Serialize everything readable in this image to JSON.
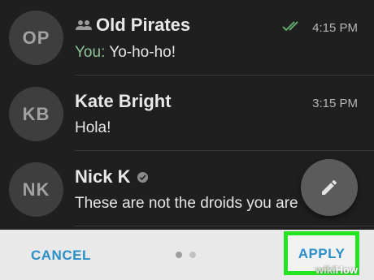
{
  "chats": [
    {
      "initials": "OP",
      "name": "Old Pirates",
      "group": true,
      "verified": false,
      "sender": "You:",
      "preview": "Yo-ho-ho!",
      "time": "4:15 PM",
      "read": true
    },
    {
      "initials": "KB",
      "name": "Kate Bright",
      "group": false,
      "verified": false,
      "sender": "",
      "preview": "Hola!",
      "time": "3:15 PM",
      "read": false
    },
    {
      "initials": "NK",
      "name": "Nick K",
      "group": false,
      "verified": true,
      "sender": "",
      "preview": "These are not the droids you are",
      "time": "",
      "read": false
    }
  ],
  "compose_fab": {
    "icon": "pencil-icon"
  },
  "bottom_bar": {
    "cancel_label": "CANCEL",
    "apply_label": "APPLY",
    "pages": 2,
    "active_page": 1
  },
  "watermark": {
    "part1": "wiki",
    "part2": "How"
  },
  "colors": {
    "background": "#1f1f1f",
    "accent": "#2a8fc8",
    "highlight": "#22e41f",
    "sender": "#8fc49a"
  }
}
